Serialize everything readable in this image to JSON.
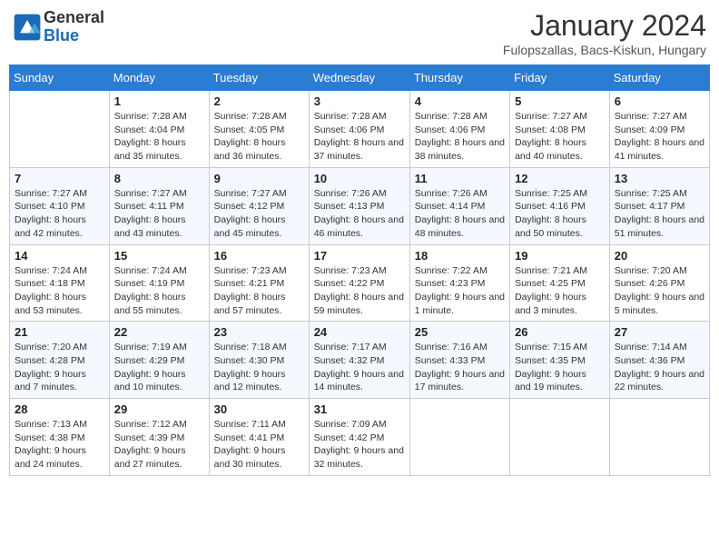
{
  "header": {
    "logo_general": "General",
    "logo_blue": "Blue",
    "month": "January 2024",
    "location": "Fulopszallas, Bacs-Kiskun, Hungary"
  },
  "days_of_week": [
    "Sunday",
    "Monday",
    "Tuesday",
    "Wednesday",
    "Thursday",
    "Friday",
    "Saturday"
  ],
  "weeks": [
    [
      {
        "day": "",
        "sunrise": "",
        "sunset": "",
        "daylight": ""
      },
      {
        "day": "1",
        "sunrise": "Sunrise: 7:28 AM",
        "sunset": "Sunset: 4:04 PM",
        "daylight": "Daylight: 8 hours and 35 minutes."
      },
      {
        "day": "2",
        "sunrise": "Sunrise: 7:28 AM",
        "sunset": "Sunset: 4:05 PM",
        "daylight": "Daylight: 8 hours and 36 minutes."
      },
      {
        "day": "3",
        "sunrise": "Sunrise: 7:28 AM",
        "sunset": "Sunset: 4:06 PM",
        "daylight": "Daylight: 8 hours and 37 minutes."
      },
      {
        "day": "4",
        "sunrise": "Sunrise: 7:28 AM",
        "sunset": "Sunset: 4:06 PM",
        "daylight": "Daylight: 8 hours and 38 minutes."
      },
      {
        "day": "5",
        "sunrise": "Sunrise: 7:27 AM",
        "sunset": "Sunset: 4:08 PM",
        "daylight": "Daylight: 8 hours and 40 minutes."
      },
      {
        "day": "6",
        "sunrise": "Sunrise: 7:27 AM",
        "sunset": "Sunset: 4:09 PM",
        "daylight": "Daylight: 8 hours and 41 minutes."
      }
    ],
    [
      {
        "day": "7",
        "sunrise": "Sunrise: 7:27 AM",
        "sunset": "Sunset: 4:10 PM",
        "daylight": "Daylight: 8 hours and 42 minutes."
      },
      {
        "day": "8",
        "sunrise": "Sunrise: 7:27 AM",
        "sunset": "Sunset: 4:11 PM",
        "daylight": "Daylight: 8 hours and 43 minutes."
      },
      {
        "day": "9",
        "sunrise": "Sunrise: 7:27 AM",
        "sunset": "Sunset: 4:12 PM",
        "daylight": "Daylight: 8 hours and 45 minutes."
      },
      {
        "day": "10",
        "sunrise": "Sunrise: 7:26 AM",
        "sunset": "Sunset: 4:13 PM",
        "daylight": "Daylight: 8 hours and 46 minutes."
      },
      {
        "day": "11",
        "sunrise": "Sunrise: 7:26 AM",
        "sunset": "Sunset: 4:14 PM",
        "daylight": "Daylight: 8 hours and 48 minutes."
      },
      {
        "day": "12",
        "sunrise": "Sunrise: 7:25 AM",
        "sunset": "Sunset: 4:16 PM",
        "daylight": "Daylight: 8 hours and 50 minutes."
      },
      {
        "day": "13",
        "sunrise": "Sunrise: 7:25 AM",
        "sunset": "Sunset: 4:17 PM",
        "daylight": "Daylight: 8 hours and 51 minutes."
      }
    ],
    [
      {
        "day": "14",
        "sunrise": "Sunrise: 7:24 AM",
        "sunset": "Sunset: 4:18 PM",
        "daylight": "Daylight: 8 hours and 53 minutes."
      },
      {
        "day": "15",
        "sunrise": "Sunrise: 7:24 AM",
        "sunset": "Sunset: 4:19 PM",
        "daylight": "Daylight: 8 hours and 55 minutes."
      },
      {
        "day": "16",
        "sunrise": "Sunrise: 7:23 AM",
        "sunset": "Sunset: 4:21 PM",
        "daylight": "Daylight: 8 hours and 57 minutes."
      },
      {
        "day": "17",
        "sunrise": "Sunrise: 7:23 AM",
        "sunset": "Sunset: 4:22 PM",
        "daylight": "Daylight: 8 hours and 59 minutes."
      },
      {
        "day": "18",
        "sunrise": "Sunrise: 7:22 AM",
        "sunset": "Sunset: 4:23 PM",
        "daylight": "Daylight: 9 hours and 1 minute."
      },
      {
        "day": "19",
        "sunrise": "Sunrise: 7:21 AM",
        "sunset": "Sunset: 4:25 PM",
        "daylight": "Daylight: 9 hours and 3 minutes."
      },
      {
        "day": "20",
        "sunrise": "Sunrise: 7:20 AM",
        "sunset": "Sunset: 4:26 PM",
        "daylight": "Daylight: 9 hours and 5 minutes."
      }
    ],
    [
      {
        "day": "21",
        "sunrise": "Sunrise: 7:20 AM",
        "sunset": "Sunset: 4:28 PM",
        "daylight": "Daylight: 9 hours and 7 minutes."
      },
      {
        "day": "22",
        "sunrise": "Sunrise: 7:19 AM",
        "sunset": "Sunset: 4:29 PM",
        "daylight": "Daylight: 9 hours and 10 minutes."
      },
      {
        "day": "23",
        "sunrise": "Sunrise: 7:18 AM",
        "sunset": "Sunset: 4:30 PM",
        "daylight": "Daylight: 9 hours and 12 minutes."
      },
      {
        "day": "24",
        "sunrise": "Sunrise: 7:17 AM",
        "sunset": "Sunset: 4:32 PM",
        "daylight": "Daylight: 9 hours and 14 minutes."
      },
      {
        "day": "25",
        "sunrise": "Sunrise: 7:16 AM",
        "sunset": "Sunset: 4:33 PM",
        "daylight": "Daylight: 9 hours and 17 minutes."
      },
      {
        "day": "26",
        "sunrise": "Sunrise: 7:15 AM",
        "sunset": "Sunset: 4:35 PM",
        "daylight": "Daylight: 9 hours and 19 minutes."
      },
      {
        "day": "27",
        "sunrise": "Sunrise: 7:14 AM",
        "sunset": "Sunset: 4:36 PM",
        "daylight": "Daylight: 9 hours and 22 minutes."
      }
    ],
    [
      {
        "day": "28",
        "sunrise": "Sunrise: 7:13 AM",
        "sunset": "Sunset: 4:38 PM",
        "daylight": "Daylight: 9 hours and 24 minutes."
      },
      {
        "day": "29",
        "sunrise": "Sunrise: 7:12 AM",
        "sunset": "Sunset: 4:39 PM",
        "daylight": "Daylight: 9 hours and 27 minutes."
      },
      {
        "day": "30",
        "sunrise": "Sunrise: 7:11 AM",
        "sunset": "Sunset: 4:41 PM",
        "daylight": "Daylight: 9 hours and 30 minutes."
      },
      {
        "day": "31",
        "sunrise": "Sunrise: 7:09 AM",
        "sunset": "Sunset: 4:42 PM",
        "daylight": "Daylight: 9 hours and 32 minutes."
      },
      {
        "day": "",
        "sunrise": "",
        "sunset": "",
        "daylight": ""
      },
      {
        "day": "",
        "sunrise": "",
        "sunset": "",
        "daylight": ""
      },
      {
        "day": "",
        "sunrise": "",
        "sunset": "",
        "daylight": ""
      }
    ]
  ]
}
